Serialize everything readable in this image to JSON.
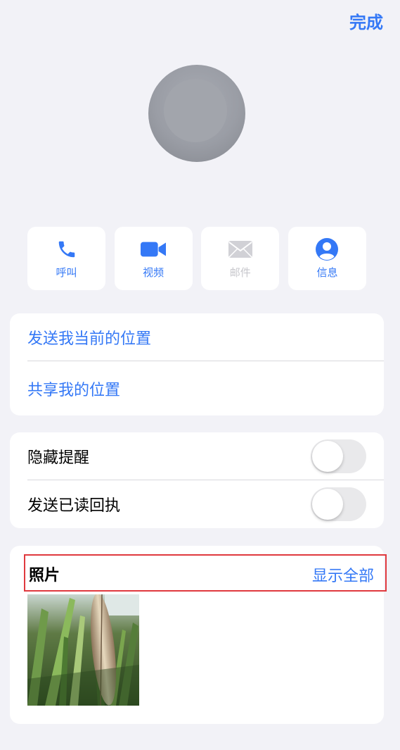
{
  "header": {
    "done_label": "完成"
  },
  "actions": [
    {
      "label": "呼叫",
      "icon": "phone-icon",
      "enabled": true
    },
    {
      "label": "视频",
      "icon": "video-camera-icon",
      "enabled": true
    },
    {
      "label": "邮件",
      "icon": "mail-icon",
      "enabled": false
    },
    {
      "label": "信息",
      "icon": "person-icon",
      "enabled": true
    }
  ],
  "location": {
    "send_current": "发送我当前的位置",
    "share": "共享我的位置"
  },
  "toggles": [
    {
      "label": "隐藏提醒",
      "on": false
    },
    {
      "label": "发送已读回执",
      "on": false
    }
  ],
  "photos": {
    "title": "照片",
    "show_all": "显示全部"
  },
  "colors": {
    "accent": "#3478f6",
    "background": "#f2f2f7",
    "highlight_border": "#e0393e"
  }
}
